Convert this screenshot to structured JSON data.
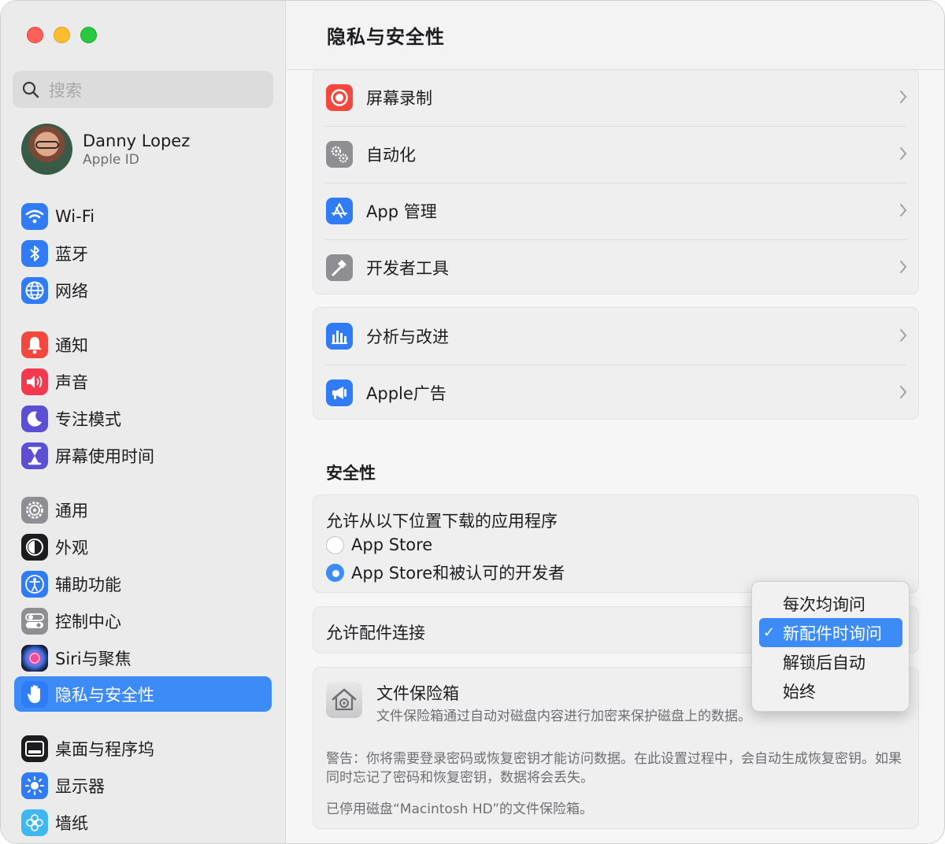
{
  "sidebar": {
    "search_placeholder": "搜索",
    "profile": {
      "name": "Danny Lopez",
      "subtitle": "Apple ID"
    },
    "items": [
      {
        "label": "Wi-Fi",
        "icon": "wifi-icon",
        "color": "#2f7cf6"
      },
      {
        "label": "蓝牙",
        "icon": "bluetooth-icon",
        "color": "#2f7cf6"
      },
      {
        "label": "网络",
        "icon": "globe-icon",
        "color": "#2f7cf6"
      },
      {
        "label": "通知",
        "icon": "bell-icon",
        "color": "#f4473d"
      },
      {
        "label": "声音",
        "icon": "speaker-icon",
        "color": "#f4394e"
      },
      {
        "label": "专注模式",
        "icon": "moon-icon",
        "color": "#5d4fd3"
      },
      {
        "label": "屏幕使用时间",
        "icon": "hourglass-icon",
        "color": "#5d4fd3"
      },
      {
        "label": "通用",
        "icon": "gear-icon",
        "color": "#8e8e93"
      },
      {
        "label": "外观",
        "icon": "appearance-icon",
        "color": "#1d1d1f"
      },
      {
        "label": "辅助功能",
        "icon": "accessibility-icon",
        "color": "#2f7cf6"
      },
      {
        "label": "控制中心",
        "icon": "toggles-icon",
        "color": "#8e8e93"
      },
      {
        "label": "Siri与聚焦",
        "icon": "siri-icon",
        "color": "#7a3cd6"
      },
      {
        "label": "隐私与安全性",
        "icon": "hand-icon",
        "color": "#2f7cf6",
        "selected": true
      },
      {
        "label": "桌面与程序坞",
        "icon": "dock-icon",
        "color": "#1d1d1f"
      },
      {
        "label": "显示器",
        "icon": "sun-icon",
        "color": "#2f7cf6"
      },
      {
        "label": "墙纸",
        "icon": "flower-icon",
        "color": "#3fb7f0"
      }
    ]
  },
  "header": {
    "title": "隐私与安全性"
  },
  "privacy_group_1": [
    {
      "label": "屏幕录制",
      "icon": "record-icon"
    },
    {
      "label": "自动化",
      "icon": "gears-icon"
    },
    {
      "label": "App 管理",
      "icon": "app-store-icon"
    },
    {
      "label": "开发者工具",
      "icon": "hammer-icon"
    }
  ],
  "privacy_group_2": [
    {
      "label": "分析与改进",
      "icon": "chart-icon"
    },
    {
      "label": "Apple广告",
      "icon": "megaphone-icon"
    }
  ],
  "security": {
    "section_title": "安全性",
    "gatekeeper": {
      "title": "允许从以下位置下载的应用程序",
      "options": [
        {
          "label": "App Store",
          "selected": false
        },
        {
          "label": "App Store和被认可的开发者",
          "selected": true
        }
      ]
    },
    "accessories": {
      "label": "允许配件连接"
    },
    "filevault": {
      "title": "文件保险箱",
      "description": "文件保险箱通过自动对磁盘内容进行加密来保护磁盘上的数据。",
      "warning": "警告：你将需要登录密码或恢复密钥才能访问数据。在此设置过程中，会自动生成恢复密钥。如果同时忘记了密码和恢复密钥，数据将会丢失。",
      "status": "已停用磁盘“Macintosh HD”的文件保险箱。"
    }
  },
  "accessory_menu": {
    "options": [
      "每次均询问",
      "新配件时询问",
      "解锁后自动",
      "始终"
    ],
    "selected_index": 1
  },
  "colors": {
    "accent": "#3d8bf7"
  }
}
